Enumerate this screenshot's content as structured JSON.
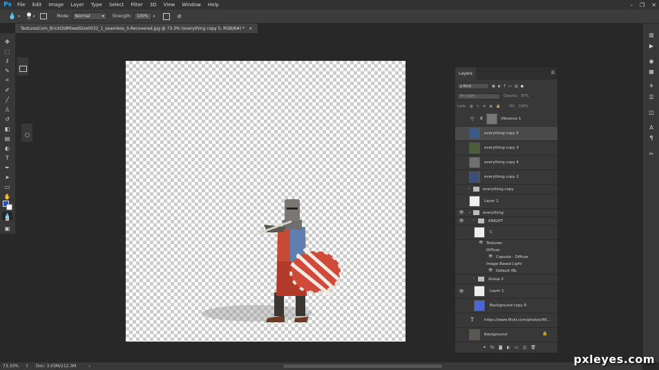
{
  "app": {
    "logo": "Ps"
  },
  "menu": [
    "File",
    "Edit",
    "Image",
    "Layer",
    "Type",
    "Select",
    "Filter",
    "3D",
    "View",
    "Window",
    "Help"
  ],
  "window_controls": [
    "–",
    "❐",
    "✕"
  ],
  "options": {
    "brush_size": "15",
    "mode_label": "Mode:",
    "mode_value": "Normal",
    "strength_label": "Strength:",
    "strength_value": "100%"
  },
  "document": {
    "tab_title": "TexturesCom_BrickOldMixedSize0032_1_seamless_S-Recovered.jpg @ 73.3% (everything copy 5, RGB/8#) *",
    "tab_close": "×"
  },
  "layers_panel": {
    "title": "Layers",
    "kind_label": "ρ Kind",
    "blend_mode": "Pin Light",
    "opacity_label": "Opacity:",
    "opacity_value": "87%",
    "lock_label": "Lock:",
    "fill_label": "Fill:",
    "fill_value": "100%",
    "layers": [
      {
        "name": "Vibrance 1",
        "type": "adjustment",
        "visible": false,
        "selected": false
      },
      {
        "name": "everything copy 5",
        "type": "image",
        "visible": false,
        "selected": true
      },
      {
        "name": "everything copy 3",
        "type": "image",
        "visible": false,
        "selected": false
      },
      {
        "name": "everything copy 4",
        "type": "gray",
        "visible": false,
        "selected": false
      },
      {
        "name": "everything copy 2",
        "type": "image",
        "visible": false,
        "selected": false
      },
      {
        "name": "everything copy",
        "type": "group",
        "visible": false,
        "selected": false
      },
      {
        "name": "Layer 1",
        "type": "transparent",
        "visible": false,
        "selected": false
      },
      {
        "name": "everything",
        "type": "group-open",
        "visible": true,
        "selected": false
      },
      {
        "name": "KNIGHT",
        "type": "group",
        "visible": true,
        "selected": false
      },
      {
        "name": "C",
        "type": "3d",
        "visible": false,
        "selected": false
      },
      {
        "name": "Textures",
        "type": "sub",
        "visible": true
      },
      {
        "name": "Diffuse",
        "type": "sub-italic"
      },
      {
        "name": "Capsule - Diffuse",
        "type": "sub2",
        "visible": true
      },
      {
        "name": "Image Based Light",
        "type": "sub-italic"
      },
      {
        "name": "Default IBL",
        "type": "sub2",
        "visible": true
      },
      {
        "name": "Group 2",
        "type": "group",
        "visible": false,
        "selected": false
      },
      {
        "name": "Layer 1",
        "type": "transparent",
        "visible": true,
        "selected": false
      },
      {
        "name": "Background copy 8",
        "type": "blue",
        "visible": false,
        "selected": false
      },
      {
        "name": "https://www.flickr.com/photos/48...",
        "type": "text",
        "visible": false,
        "selected": false
      },
      {
        "name": "Background",
        "type": "bg",
        "visible": false,
        "selected": false
      }
    ],
    "bottom_icons": [
      "link-icon",
      "fx-icon",
      "mask-icon",
      "adjustment-icon",
      "folder-icon",
      "new-layer-icon",
      "trash-icon"
    ]
  },
  "status": {
    "zoom": "73.33%",
    "doc": "Doc: 3.03M/112.3M"
  },
  "watermark": "pxleyes.com",
  "colors": {
    "foreground": "#1f4fd8",
    "background": "#ffffff",
    "accent": "#2fa3f5"
  }
}
